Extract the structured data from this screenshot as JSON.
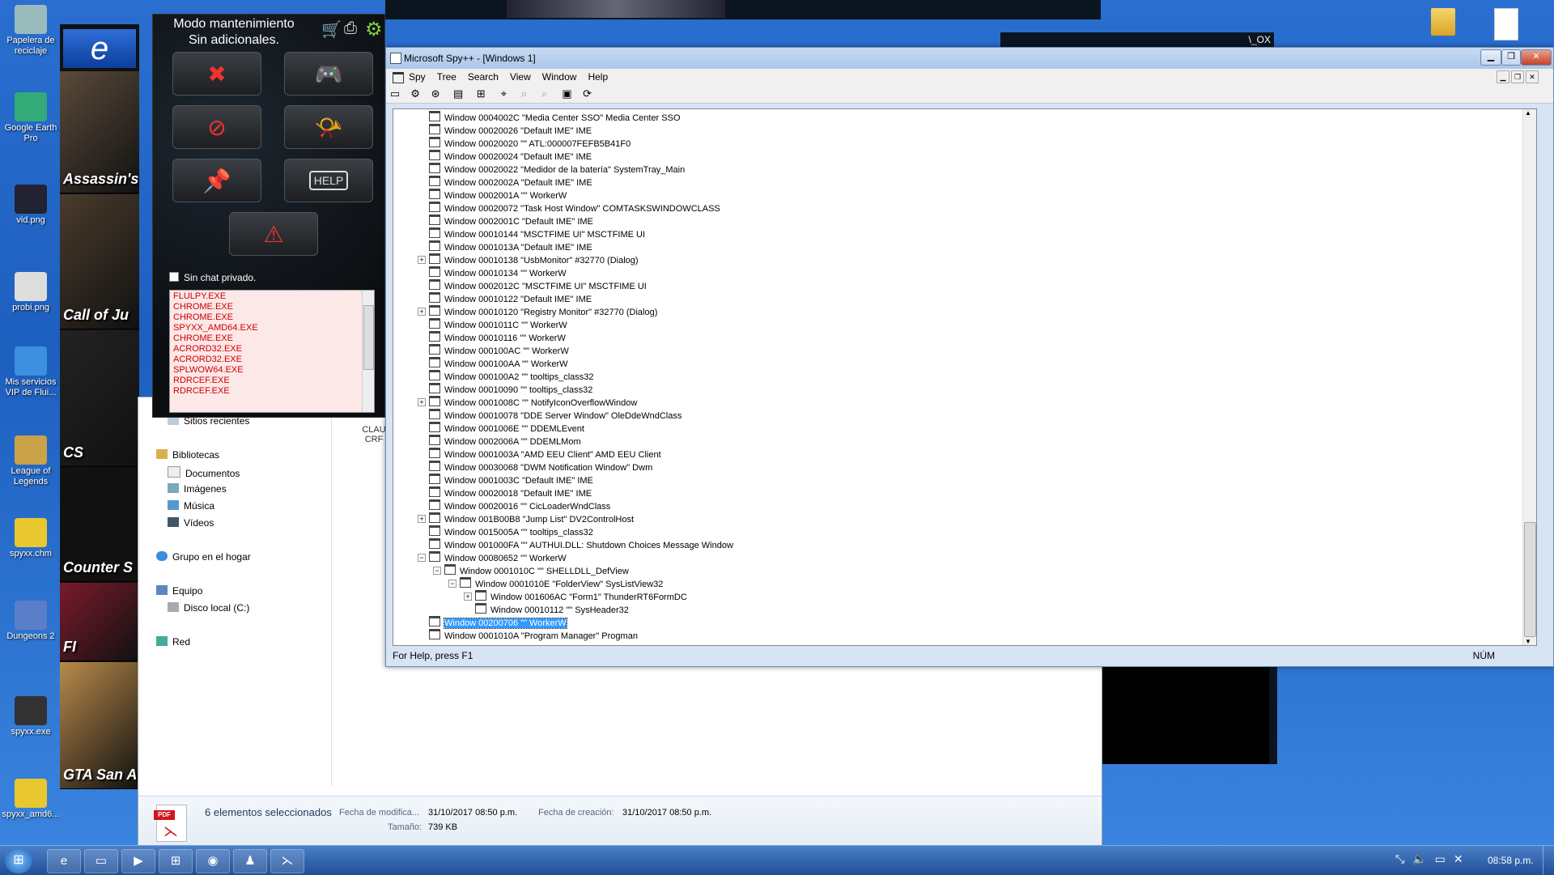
{
  "desktop_icons": [
    {
      "label": "Papelera de reciclaje",
      "icon": "recycle-bin-icon"
    },
    {
      "label": "Google Earth Pro",
      "icon": "google-earth-icon"
    },
    {
      "label": "vid.png",
      "icon": "image-file-icon"
    },
    {
      "label": "probi.png",
      "icon": "image-file-icon"
    },
    {
      "label": "Mis servicios VIP de Flui...",
      "icon": "vip-services-icon"
    },
    {
      "label": "League of Legends",
      "icon": "folder-icon"
    },
    {
      "label": "spyxx.chm",
      "icon": "help-file-icon"
    },
    {
      "label": "Dungeons 2",
      "icon": "game-icon"
    },
    {
      "label": "spyxx.exe",
      "icon": "spy-icon"
    },
    {
      "label": "spyxx_amd6...",
      "icon": "help-file-icon"
    }
  ],
  "games": [
    "",
    "Assassin's Cr",
    "Call of Ju",
    "CS",
    "Counter S",
    "FI",
    "GTA San A"
  ],
  "maintenance_panel": {
    "title_line1": "Modo mantenimiento",
    "title_line2": "Sin adicionales.",
    "private_chat_label": "Sin chat privado.",
    "processes": [
      "FLULPY.EXE",
      "CHROME.EXE",
      "CHROME.EXE",
      "SPYXX_AMD64.EXE",
      "CHROME.EXE",
      "ACRORD32.EXE",
      "ACRORD32.EXE",
      "SPLWOW64.EXE",
      "RDRCEF.EXE",
      "RDRCEF.EXE"
    ]
  },
  "explorer": {
    "nav": {
      "recent": "Sitios recientes",
      "libraries": "Bibliotecas",
      "documents": "Documentos",
      "images": "Imágenes",
      "music": "Música",
      "videos": "Vídeos",
      "homegroup": "Grupo en el hogar",
      "computer": "Equipo",
      "local_disk": "Disco local (C:)",
      "network": "Red"
    },
    "file_caption1": "CLAU",
    "file_caption2": "CRF",
    "details": {
      "selected": "6 elementos seleccionados",
      "modified_label": "Fecha de modifica...",
      "modified_value": "31/10/2017 08:50 p.m.",
      "created_label": "Fecha de creación:",
      "created_value": "31/10/2017 08:50 p.m.",
      "size_label": "Tamaño:",
      "size_value": "739 KB"
    }
  },
  "bg_window_controls": "\\_OX",
  "spy": {
    "title": "Microsoft Spy++ - [Windows 1]",
    "menu": [
      "Spy",
      "Tree",
      "Search",
      "View",
      "Window",
      "Help"
    ],
    "tree": [
      {
        "text": "Window 0004002C \"Media Center SSO\" Media Center SSO",
        "level": 0
      },
      {
        "text": "Window 00020026 \"Default IME\" IME",
        "level": 0
      },
      {
        "text": "Window 00020020 \"\" ATL:000007FEFB5B41F0",
        "level": 0
      },
      {
        "text": "Window 00020024 \"Default IME\" IME",
        "level": 0
      },
      {
        "text": "Window 00020022 \"Medidor de la batería\" SystemTray_Main",
        "level": 0
      },
      {
        "text": "Window 0002002A \"Default IME\" IME",
        "level": 0
      },
      {
        "text": "Window 0002001A \"\" WorkerW",
        "level": 0
      },
      {
        "text": "Window 00020072 \"Task Host Window\" COMTASKSWINDOWCLASS",
        "level": 0
      },
      {
        "text": "Window 0002001C \"Default IME\" IME",
        "level": 0
      },
      {
        "text": "Window 00010144 \"MSCTFIME UI\" MSCTFIME UI",
        "level": 0
      },
      {
        "text": "Window 0001013A \"Default IME\" IME",
        "level": 0
      },
      {
        "text": "Window 00010138 \"UsbMonitor\" #32770 (Dialog)",
        "level": 0,
        "expander": "+"
      },
      {
        "text": "Window 00010134 \"\" WorkerW",
        "level": 0
      },
      {
        "text": "Window 0002012C \"MSCTFIME UI\" MSCTFIME UI",
        "level": 0
      },
      {
        "text": "Window 00010122 \"Default IME\" IME",
        "level": 0
      },
      {
        "text": "Window 00010120 \"Registry Monitor\" #32770 (Dialog)",
        "level": 0,
        "expander": "+"
      },
      {
        "text": "Window 0001011C \"\" WorkerW",
        "level": 0
      },
      {
        "text": "Window 00010116 \"\" WorkerW",
        "level": 0
      },
      {
        "text": "Window 000100AC \"\" WorkerW",
        "level": 0
      },
      {
        "text": "Window 000100AA \"\" WorkerW",
        "level": 0
      },
      {
        "text": "Window 000100A2 \"\" tooltips_class32",
        "level": 0
      },
      {
        "text": "Window 00010090 \"\" tooltips_class32",
        "level": 0
      },
      {
        "text": "Window 0001008C \"\" NotifyIconOverflowWindow",
        "level": 0,
        "expander": "+"
      },
      {
        "text": "Window 00010078 \"DDE Server Window\" OleDdeWndClass",
        "level": 0
      },
      {
        "text": "Window 0001006E \"\" DDEMLEvent",
        "level": 0
      },
      {
        "text": "Window 0002006A \"\" DDEMLMom",
        "level": 0
      },
      {
        "text": "Window 0001003A \"AMD EEU Client\" AMD EEU Client",
        "level": 0
      },
      {
        "text": "Window 00030068 \"DWM Notification Window\" Dwm",
        "level": 0
      },
      {
        "text": "Window 0001003C \"Default IME\" IME",
        "level": 0
      },
      {
        "text": "Window 00020018 \"Default IME\" IME",
        "level": 0
      },
      {
        "text": "Window 00020016 \"\" CicLoaderWndClass",
        "level": 0
      },
      {
        "text": "Window 001B00B8 \"Jump List\" DV2ControlHost",
        "level": 0,
        "expander": "+"
      },
      {
        "text": "Window 0015005A \"\" tooltips_class32",
        "level": 0
      },
      {
        "text": "Window 001000FA \"\" AUTHUI.DLL: Shutdown Choices Message Window",
        "level": 0
      },
      {
        "text": "Window 00080652 \"\" WorkerW",
        "level": 0,
        "expander": "−"
      },
      {
        "text": "Window 0001010C \"\" SHELLDLL_DefView",
        "level": 1,
        "expander": "−"
      },
      {
        "text": "Window 0001010E \"FolderView\" SysListView32",
        "level": 2,
        "expander": "−"
      },
      {
        "text": "Window 001606AC \"Form1\" ThunderRT6FormDC",
        "level": 3,
        "expander": "+"
      },
      {
        "text": "Window 00010112 \"\" SysHeader32",
        "level": 3
      },
      {
        "text": "Window 00200706 \"\" WorkerW",
        "level": 0,
        "selected": true
      },
      {
        "text": "Window 0001010A \"Program Manager\" Progman",
        "level": 0
      }
    ],
    "status_left": "For Help, press F1",
    "status_right": "NÚM"
  },
  "taskbar": {
    "clock": "08:58 p.m."
  }
}
